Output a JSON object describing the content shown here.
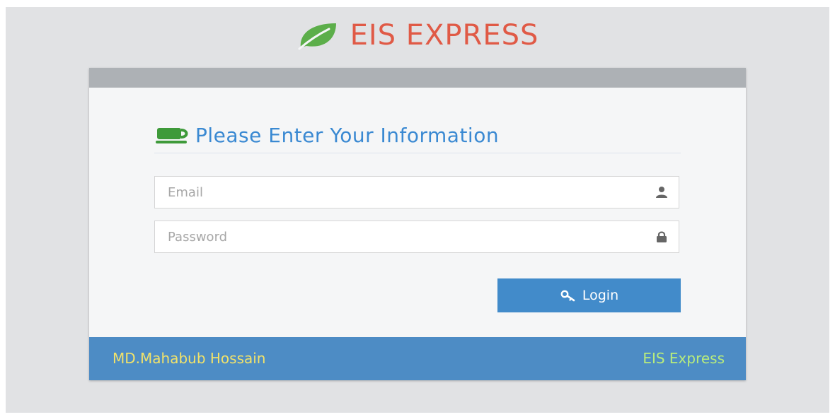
{
  "brand": {
    "title": "EIS EXPRESS",
    "icon": "leaf-icon",
    "title_color": "#e05a46",
    "icon_color": "#5cae4a"
  },
  "form": {
    "heading": "Please Enter Your Information",
    "heading_icon": "coffee-cup-icon",
    "heading_color": "#3a89d2",
    "email": {
      "placeholder": "Email",
      "value": "",
      "icon": "user-icon"
    },
    "password": {
      "placeholder": "Password",
      "value": "",
      "icon": "lock-icon"
    },
    "login_button": {
      "label": "Login",
      "icon": "key-icon",
      "color": "#428bca"
    }
  },
  "footer": {
    "left_text": "MD.Mahabub Hossain",
    "right_text": "EIS Express",
    "background_color": "#4d8cc5",
    "left_color": "#f1e26a",
    "right_color": "#b8ec7c"
  }
}
